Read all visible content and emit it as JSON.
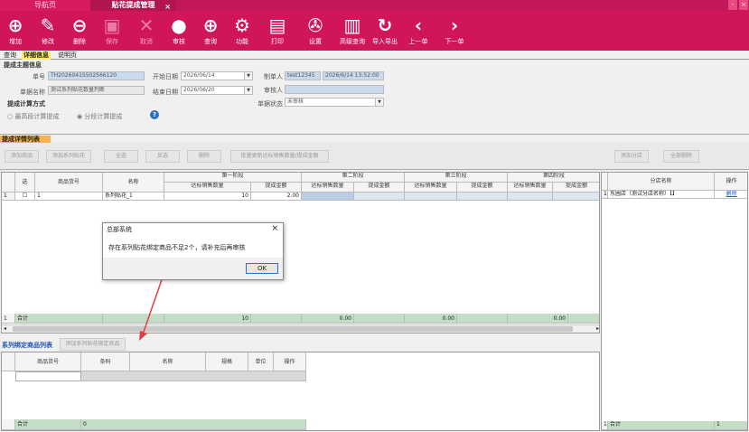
{
  "tabs": {
    "nav": "导航页",
    "main": "贴花提成管理",
    "close": "×"
  },
  "window": {
    "min": "-",
    "close": "×"
  },
  "toolbar": [
    {
      "name": "add",
      "icon": "plus-circle-icon",
      "glyph": "⊕",
      "label": "增加",
      "enabled": true
    },
    {
      "name": "edit",
      "icon": "pencil-icon",
      "glyph": "✎",
      "label": "修改",
      "enabled": true
    },
    {
      "name": "delete",
      "icon": "minus-circle-icon",
      "glyph": "⊖",
      "label": "删除",
      "enabled": true
    },
    {
      "name": "save",
      "icon": "floppy-icon",
      "glyph": "▣",
      "label": "保存",
      "enabled": false
    },
    {
      "name": "cancel",
      "icon": "x-icon",
      "glyph": "✕",
      "label": "取消",
      "enabled": false
    },
    {
      "name": "audit",
      "icon": "user-icon",
      "glyph": "●",
      "label": "审核",
      "enabled": true
    },
    {
      "name": "query",
      "icon": "zoom-icon",
      "glyph": "⊕",
      "label": "查询",
      "enabled": true
    },
    {
      "name": "function",
      "icon": "gear-icon",
      "glyph": "⚙",
      "label": "功能",
      "enabled": true
    },
    {
      "name": "print",
      "icon": "printer-icon",
      "glyph": "▤",
      "label": "打印",
      "enabled": true
    },
    {
      "name": "settings",
      "icon": "wrench-icon",
      "glyph": "✇",
      "label": "设置",
      "enabled": true
    },
    {
      "name": "expand",
      "icon": "document-icon",
      "glyph": "▥",
      "label": "高级查询",
      "enabled": true
    },
    {
      "name": "import",
      "icon": "refresh-icon",
      "glyph": "↻",
      "label": "导入导出",
      "enabled": true
    },
    {
      "name": "prev",
      "icon": "chevron-left-icon",
      "glyph": "‹",
      "label": "上一单",
      "enabled": true
    },
    {
      "name": "next",
      "icon": "chevron-right-icon",
      "glyph": "›",
      "label": "下一单",
      "enabled": true
    }
  ],
  "page_tabs": [
    "查询",
    "详细信息",
    "说明页"
  ],
  "header": {
    "section": "提成主题信息",
    "doc_no_label": "单号",
    "doc_no": "TH2026041S502566120",
    "doc_name_label": "单据名称",
    "doc_name": "测试系列贴花数量判断",
    "start_label": "开始日期",
    "start": "2026/06/14",
    "end_label": "结束日期",
    "end": "2026/06/20",
    "maker_label": "制单人",
    "maker": "test12345",
    "make_time": "2026/6/14 13:52:00",
    "auditor_label": "审核人",
    "auditor": "",
    "status_label": "单据状态",
    "status": "未审核",
    "calc_label": "提成计算方式",
    "opt1": "最高段计算提成",
    "opt2": "分段计算提成",
    "help": "?"
  },
  "detail": {
    "section": "提成详情列表",
    "buttons": [
      "添加商品",
      "添加系列贴花",
      "全选",
      "反选",
      "删除",
      "批量更新达标销售数量/提成金额"
    ],
    "sel": "选",
    "col_code": "商品货号",
    "col_name": "名称",
    "stages": [
      "第一阶段",
      "第二阶段",
      "第三阶段",
      "第四阶段"
    ],
    "sub_qty": "达标销售数量",
    "sub_amt": "提成金额",
    "rows": [
      {
        "idx": "1",
        "code": "1",
        "name": "系列贴花_1",
        "qty1": "10",
        "amt1": "2.00"
      }
    ],
    "total_idx": "1",
    "total_label": "合计",
    "totals": [
      "10",
      "0.00",
      "0.00",
      "0.00"
    ]
  },
  "binding": {
    "section": "系列绑定商品列表",
    "add_btn": "添加系列贴花绑定商品",
    "cols": [
      "商品货号",
      "条码",
      "名称",
      "规格",
      "单位",
      "操作"
    ],
    "total_label": "合计",
    "total_val": "0"
  },
  "store": {
    "add_btn": "添加分店",
    "del_all": "全部删除",
    "col_name": "分店名称",
    "col_op": "操作",
    "row": {
      "idx": "1",
      "name": "东圃店（测试分店名称）【】",
      "op": "删除"
    },
    "total_idx": "1",
    "total_label": "合计",
    "total_val": "1"
  },
  "dialog": {
    "title": "总部系统",
    "message": "存在系列贴花绑定商品不足2个，请补充后再审核",
    "ok": "OK",
    "close": "×"
  },
  "colors": {
    "brand": "#d0155a",
    "total_row": "#c4ddc4",
    "arrow": "#e04040"
  }
}
